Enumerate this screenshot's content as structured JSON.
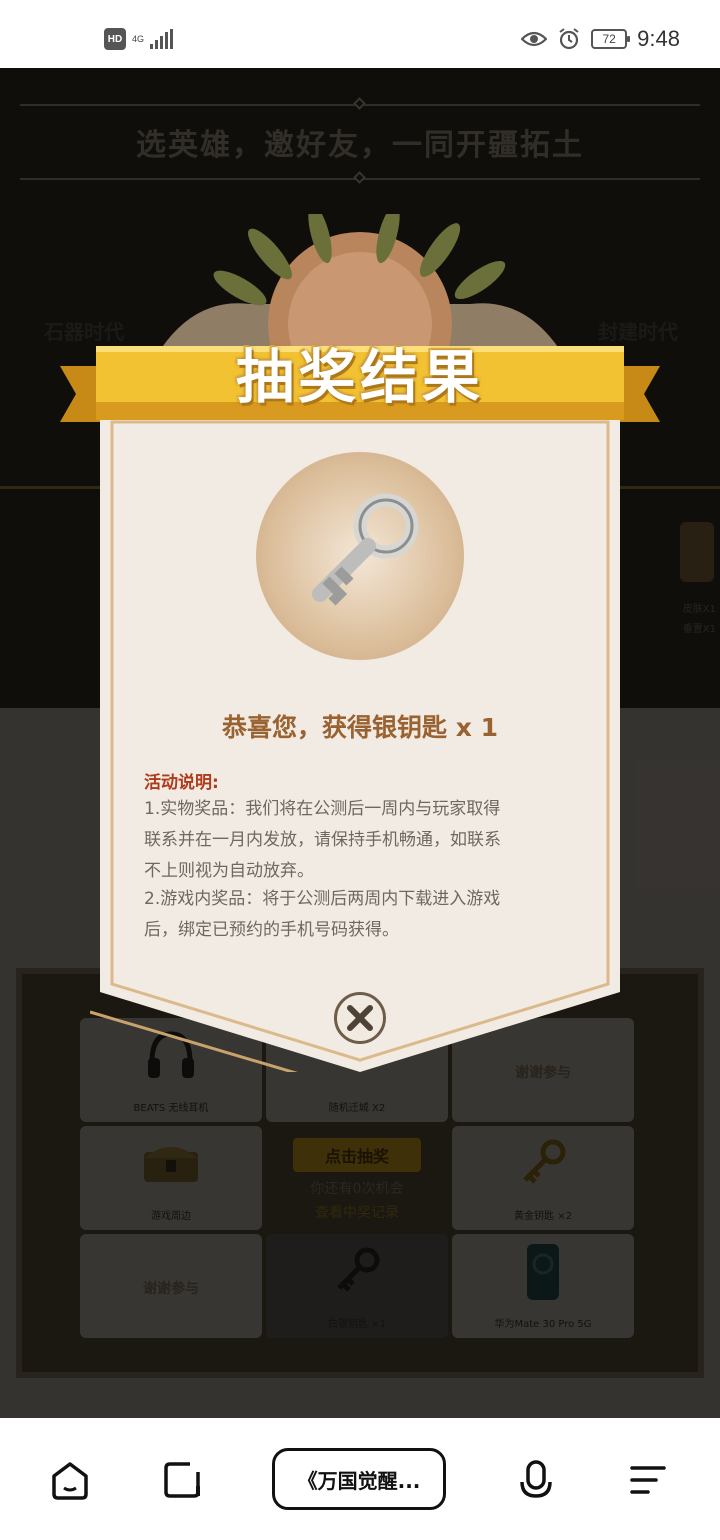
{
  "status_bar": {
    "hd": "HD",
    "network": "4G",
    "battery": "72",
    "time": "9:48"
  },
  "page": {
    "slogan": "选英雄，邀好友，一同开疆拓土",
    "era_left": "石器时代",
    "era_right": "封建时代",
    "side_peek": [
      "皮肤X1",
      "垂置X1"
    ],
    "grid": {
      "cells": [
        {
          "label": "BEATS 无线耳机",
          "icon": "headphones-icon"
        },
        {
          "label": "随机迁城 X2",
          "icon": "city-icon"
        },
        {
          "label": "谢谢参与",
          "icon": "laurel-icon"
        },
        {
          "label": "游戏周边",
          "icon": "chest-icon"
        },
        {
          "label": "黄金钥匙 ×2",
          "icon": "gold-key-icon"
        },
        {
          "label": "谢谢参与",
          "icon": "laurel-icon"
        },
        {
          "label": "白银钥匙 ×1",
          "icon": "silver-key-icon"
        },
        {
          "label": "华为Mate 30 Pro 5G",
          "icon": "phone-icon"
        }
      ],
      "draw_button": "点击抽奖",
      "chances": "你还有0次机会",
      "record_link": "查看中奖记录"
    }
  },
  "modal": {
    "title": "抽奖结果",
    "prize_icon": "silver-key-icon",
    "congrats": "恭喜您，获得银钥匙 x 1",
    "description_title": "活动说明:",
    "description_lines": [
      "1.实物奖品：我们将在公测后一周内与玩家取得",
      "联系并在一月内发放，请保持手机畅通，如联系",
      "不上则视为自动放弃。",
      "2.游戏内奖品：将于公测后两周内下载进入游戏",
      "后，绑定已预约的手机号码获得。"
    ],
    "close_icon": "close-icon"
  },
  "bottom_nav": {
    "home_icon": "home-icon",
    "tabs_icon": "tabs-icon",
    "page_title": "《万国觉醒...",
    "voice_icon": "microphone-icon",
    "menu_icon": "menu-icon"
  },
  "colors": {
    "banner_gold": "#f2c232",
    "banner_text": "#ffffff",
    "congrats": "#9a6230",
    "description_title": "#b03a1a",
    "card_background": "#f1ebe3"
  }
}
